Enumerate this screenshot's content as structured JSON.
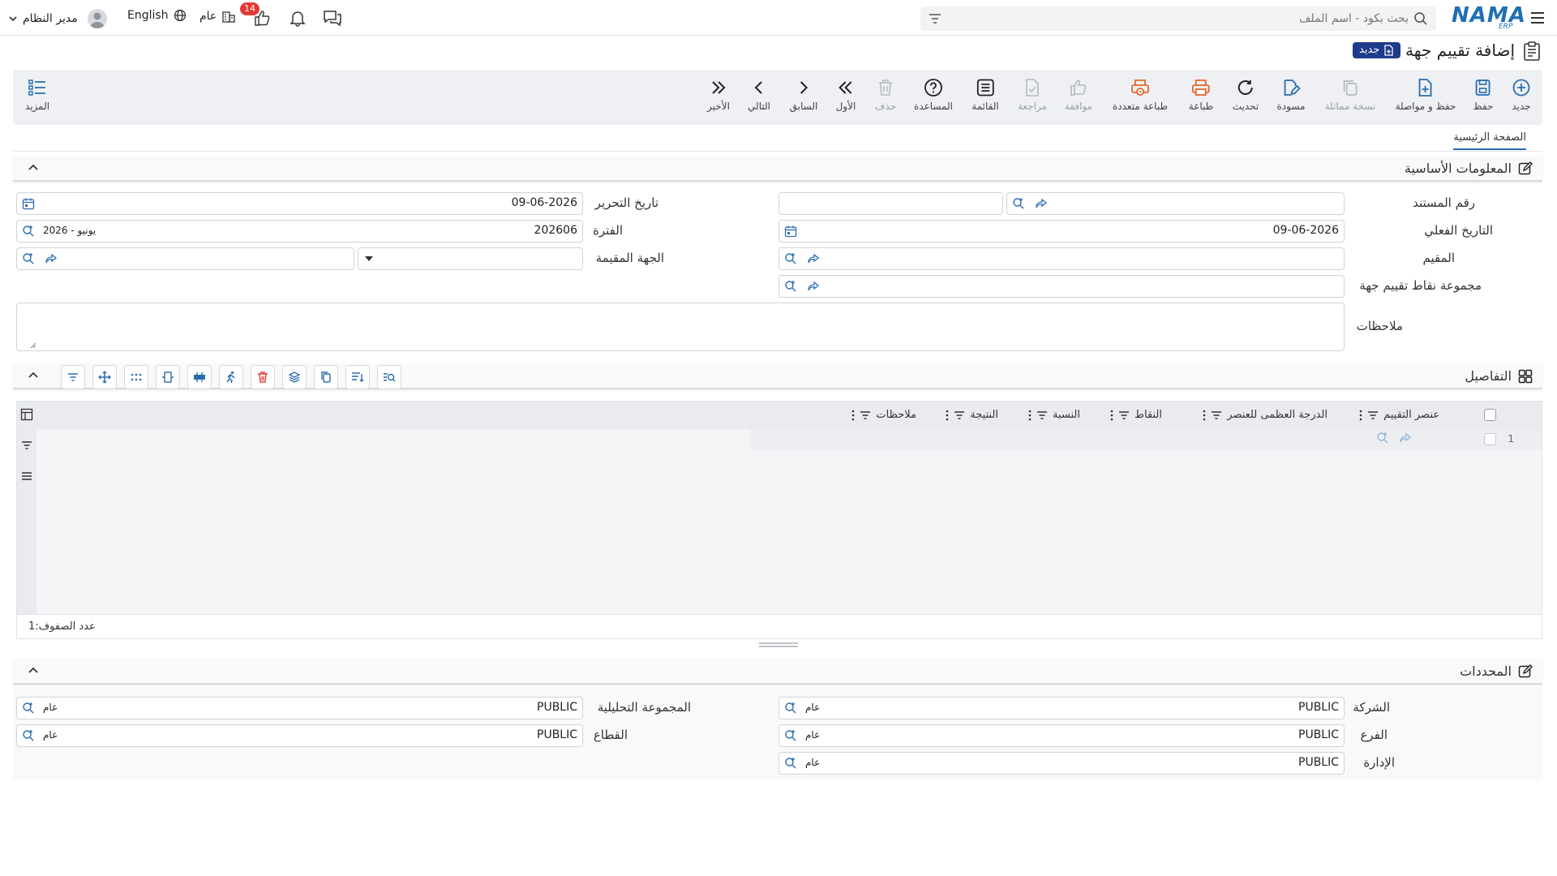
{
  "topbar": {
    "logo": "NAMA",
    "logo_sub": "ERP",
    "search_placeholder": "بحث بكود - اسم الملف",
    "user_name": "مدير النظام",
    "language": "English",
    "scope": "عام",
    "notification_count": "14"
  },
  "page": {
    "title": "إضافة تقييم جهة",
    "status_badge": "جديد"
  },
  "toolbar": {
    "new": "جديد",
    "save": "حفظ",
    "save_continue": "حفظ و مواصلة",
    "duplicate": "نسخة مماثلة",
    "draft": "مسودة",
    "refresh": "تحديث",
    "print": "طباعة",
    "multi_print": "طباعة متعددة",
    "approve": "موافقة",
    "review": "مراجعة",
    "list": "القائمة",
    "help": "المساعدة",
    "delete": "حذف",
    "first": "الأول",
    "previous": "السابق",
    "next": "التالي",
    "last": "الأخير",
    "more": "المزيد"
  },
  "tabs": {
    "main": "الصفحة الرئيسية"
  },
  "basic_info": {
    "title": "المعلومات الأساسية",
    "doc_number_label": "رقم المستند",
    "doc_number_value": "",
    "edit_date_label": "تاريخ التحرير",
    "edit_date_value": "09-06-2026",
    "actual_date_label": "التاريخ الفعلي",
    "actual_date_value": "09-06-2026",
    "period_label": "الفترة",
    "period_value": "202606",
    "period_name": "يونيو - 2026",
    "evaluator_label": "المقيم",
    "evaluator_value": "",
    "evaluating_party_label": "الجهة المقيمة",
    "evaluating_party_value": "",
    "points_group_label": "مجموعة نقاط تقييم جهة",
    "points_group_value": "",
    "notes_label": "ملاحظات",
    "notes_value": ""
  },
  "details": {
    "title": "التفاصيل",
    "columns": [
      "عنصر التقييم",
      "الدرجة العظمى للعنصر",
      "النقاط",
      "النسبة",
      "النتيجة",
      "ملاحظات"
    ],
    "rows": [
      {
        "index": "1"
      }
    ],
    "row_count_label": "عدد الصفوف:",
    "row_count_value": "1"
  },
  "dimensions": {
    "title": "المحددات",
    "company_label": "الشركة",
    "company_value": "PUBLIC",
    "company_name": "عام",
    "branch_label": "الفرع",
    "branch_value": "PUBLIC",
    "branch_name": "عام",
    "department_label": "الإدارة",
    "department_value": "PUBLIC",
    "department_name": "عام",
    "analytic_group_label": "المجموعة التحليلية",
    "analytic_group_value": "PUBLIC",
    "analytic_group_name": "عام",
    "sector_label": "القطاع",
    "sector_value": "PUBLIC",
    "sector_name": "عام"
  },
  "colors": {
    "accent": "#2a6cb0",
    "badge_bg": "#1e3a8a",
    "danger": "#e53935",
    "print_orange": "#e8652b",
    "logo_blue": "#1f6fb5"
  }
}
